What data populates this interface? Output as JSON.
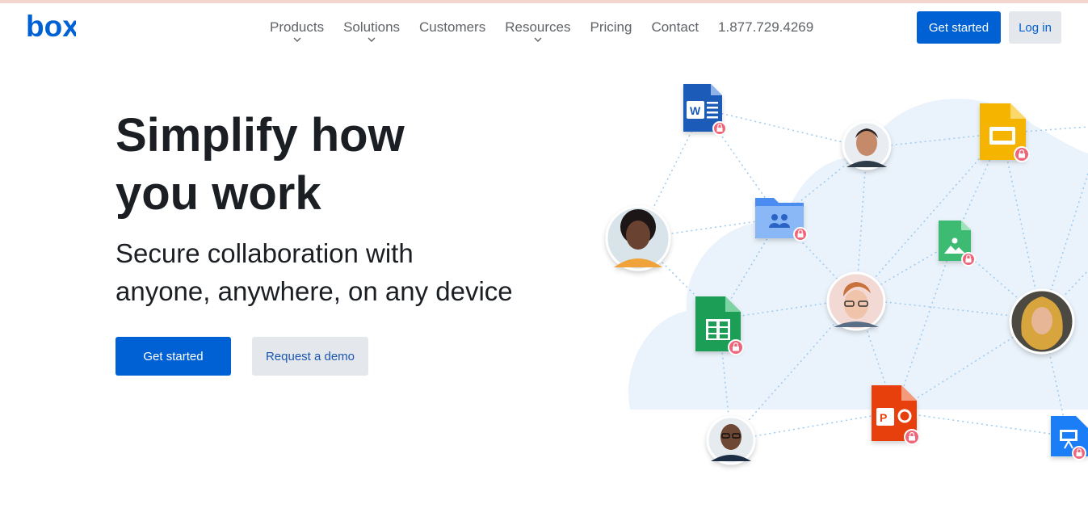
{
  "header": {
    "logo_text": "box",
    "nav": [
      {
        "label": "Products",
        "dropdown": true
      },
      {
        "label": "Solutions",
        "dropdown": true
      },
      {
        "label": "Customers",
        "dropdown": false
      },
      {
        "label": "Resources",
        "dropdown": true
      },
      {
        "label": "Pricing",
        "dropdown": false
      },
      {
        "label": "Contact",
        "dropdown": false
      }
    ],
    "phone": "1.877.729.4269",
    "get_started_label": "Get started",
    "login_label": "Log in"
  },
  "hero": {
    "title_line1": "Simplify how",
    "title_line2": "you work",
    "subtitle_line1": "Secure collaboration with",
    "subtitle_line2": "anyone, anywhere, on any device",
    "primary_cta": "Get started",
    "secondary_cta": "Request a demo"
  },
  "illustration": {
    "word_badge": "W",
    "ppt_badge": "P",
    "icons": [
      "word-doc-icon",
      "slides-doc-icon",
      "shared-folder-icon",
      "image-doc-icon",
      "sheets-doc-icon",
      "powerpoint-doc-icon",
      "keynote-doc-icon",
      "lock-icon"
    ],
    "colors": {
      "brand_blue": "#0061d5",
      "cloud": "#eaf2fb",
      "word": "#1f5cb8",
      "slides": "#f4b400",
      "sheets": "#1e9e57",
      "image": "#3dbb72",
      "folder": "#6aa8f5",
      "powerpoint": "#e8400c",
      "keynote": "#1e7ef7",
      "lock_badge": "#f0657a"
    }
  }
}
